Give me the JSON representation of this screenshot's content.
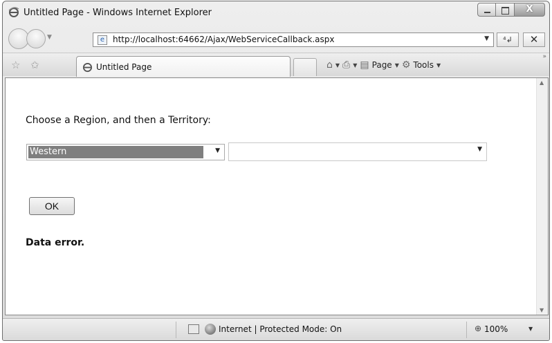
{
  "window": {
    "title": "Untitled Page - Windows Internet Explorer",
    "controls": {
      "minimize": "–",
      "maximize": "□",
      "close": "X"
    }
  },
  "address_bar": {
    "url": "http://localhost:64662/Ajax/WebServiceCallback.aspx",
    "refresh_glyph": "⁴↲",
    "stop_glyph": "✕"
  },
  "tabs": [
    {
      "label": "Untitled Page"
    }
  ],
  "command_bar": {
    "page_label": "Page",
    "tools_label": "Tools"
  },
  "content": {
    "prompt": "Choose a Region, and then a Territory:",
    "region_select": {
      "selected": "Western"
    },
    "territory_select": {
      "selected": ""
    },
    "ok_label": "OK",
    "error_message": "Data error."
  },
  "status_bar": {
    "zone": "Internet | Protected Mode: On",
    "zoom": "100%"
  },
  "icons": {
    "app": "ie-logo-icon",
    "favorites": "favorites-star-icon",
    "add_favorites": "add-favorites-icon",
    "home": "home-icon",
    "print": "print-icon",
    "page": "page-icon",
    "tools": "gear-icon",
    "globe": "globe-icon"
  }
}
